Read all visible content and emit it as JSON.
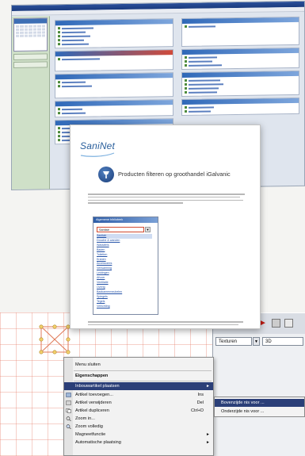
{
  "document": {
    "logo": "SaniNet",
    "heading": "Producten filteren op groothandel iGalvanic",
    "dropdown": {
      "header": "Algemene biblioteek",
      "field_value": "Sanitair",
      "items": [
        "Sanitair",
        "Douche & wanden",
        "Wastafels",
        "Baden",
        "Toiletten",
        "Kranen",
        "Accessoires",
        "Verwarming",
        "Leidingen",
        "Afvoer",
        "Ventilatie",
        "Overig",
        "Badkamermeubelen",
        "Spiegels",
        "Tegels",
        "Verlichting"
      ]
    }
  },
  "context_menu": {
    "items": [
      {
        "label": "Menu sluiten",
        "shortcut": "",
        "kind": "normal"
      },
      {
        "label": "Eigenschappen",
        "shortcut": "",
        "kind": "header"
      },
      {
        "label": "Inbouwartikel plaatsen",
        "shortcut": "",
        "kind": "highlight",
        "submenu": true
      },
      {
        "label": "Artikel toevoegen...",
        "shortcut": "Ins",
        "kind": "normal"
      },
      {
        "label": "Artikel verwijderen",
        "shortcut": "Del",
        "kind": "normal"
      },
      {
        "label": "Artikel dupliceren",
        "shortcut": "Ctrl+D",
        "kind": "normal"
      },
      {
        "label": "Zoom in...",
        "shortcut": "",
        "kind": "normal"
      },
      {
        "label": "Zoom volledig",
        "shortcut": "",
        "kind": "normal"
      },
      {
        "label": "Magneetfunctie",
        "shortcut": "",
        "kind": "normal",
        "submenu": true
      },
      {
        "label": "Automatische plaatsing",
        "shortcut": "",
        "kind": "normal",
        "submenu": true
      }
    ],
    "submenu": [
      "Bovenzijde nis voor ...",
      "Onderzijde nis voor ..."
    ]
  },
  "toolbar": {
    "combo1": "Texturen",
    "combo2": "3D"
  },
  "colors": {
    "menu_highlight": "#2b3f78",
    "panel_header": "#2f68b8",
    "accent_red": "#c21a12"
  }
}
